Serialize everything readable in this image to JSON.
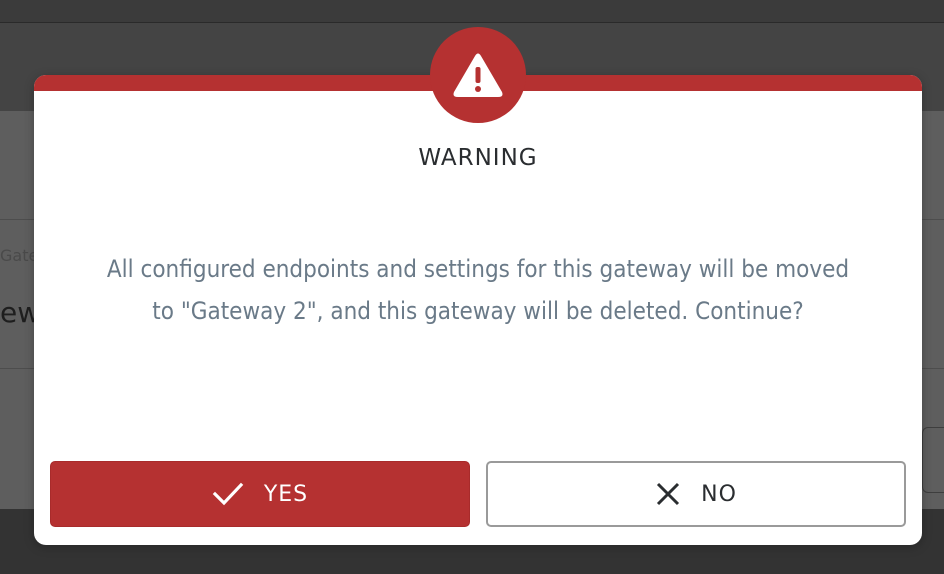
{
  "background": {
    "label_partial": "Gate",
    "value_partial": "ewa"
  },
  "dialog": {
    "title": "WARNING",
    "message": "All configured endpoints and settings for this gateway will be moved to \"Gateway 2\", and this gateway will be deleted. Continue?",
    "icon": "warning-triangle-icon",
    "accent_color": "#b53131",
    "yes_label": "YES",
    "no_label": "NO"
  }
}
